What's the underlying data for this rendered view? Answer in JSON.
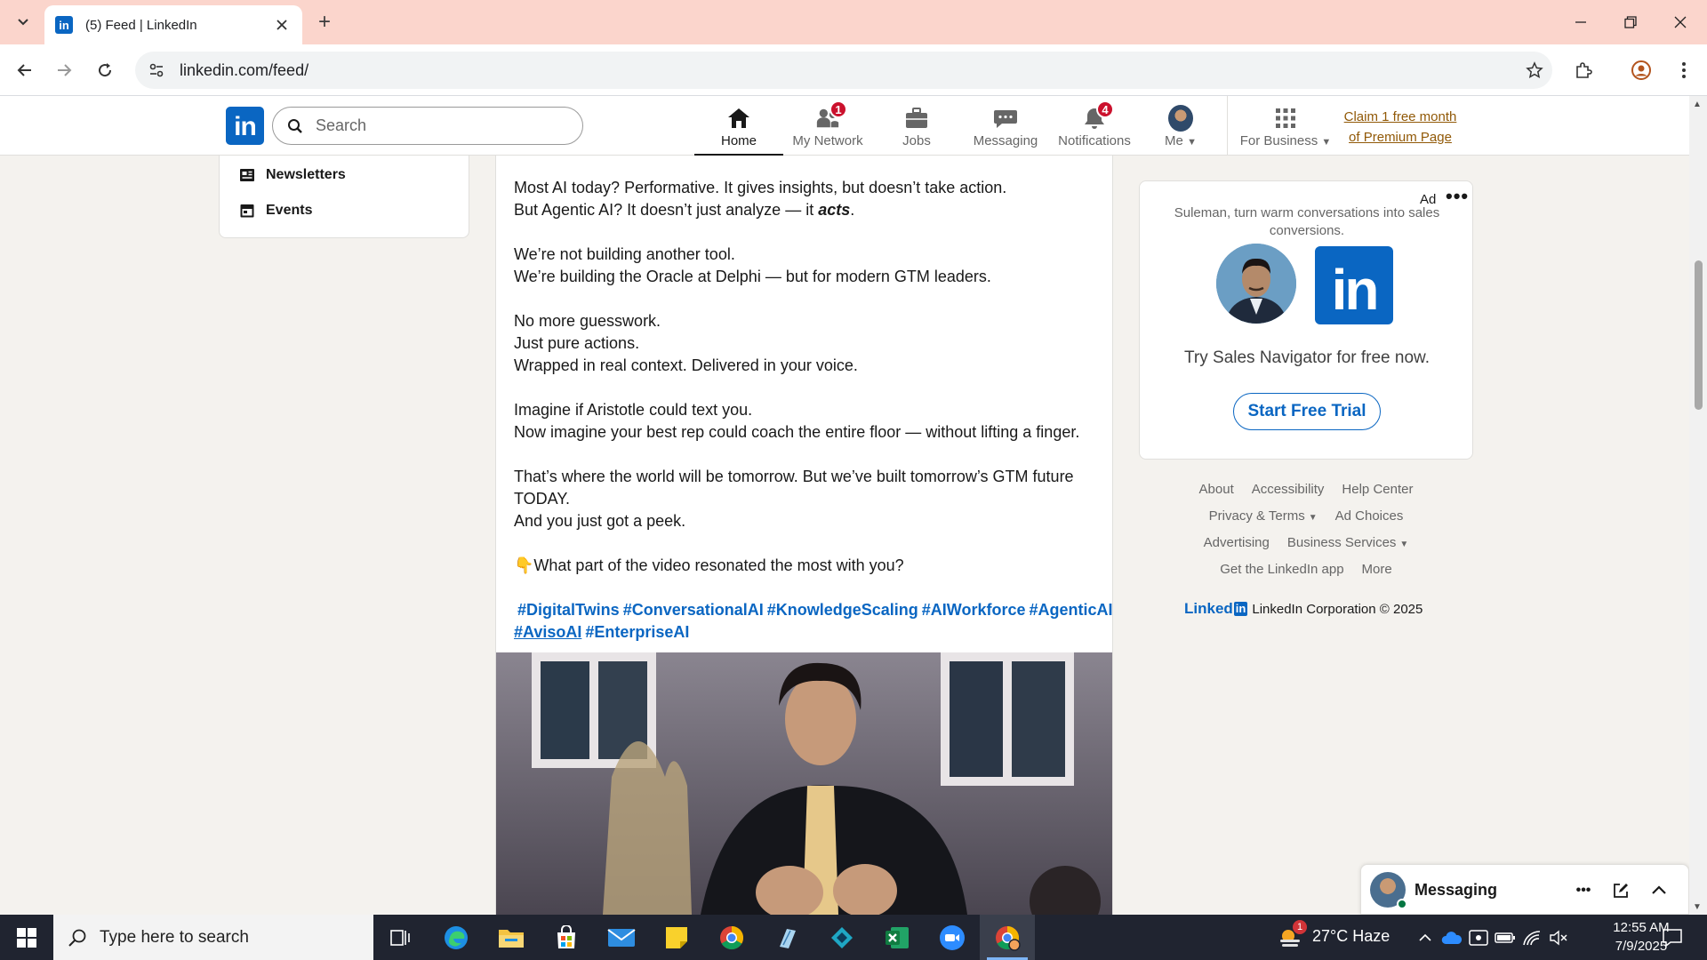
{
  "browser": {
    "tab_title": "(5) Feed | LinkedIn",
    "url": "linkedin.com/feed/",
    "new_tab": "+"
  },
  "linkedin": {
    "logo_text": "in",
    "search_placeholder": "Search",
    "nav": [
      {
        "label": "Home",
        "badge": ""
      },
      {
        "label": "My Network",
        "badge": "1"
      },
      {
        "label": "Jobs",
        "badge": ""
      },
      {
        "label": "Messaging",
        "badge": ""
      },
      {
        "label": "Notifications",
        "badge": "4"
      },
      {
        "label": "Me",
        "badge": ""
      },
      {
        "label": "For Business",
        "badge": ""
      }
    ],
    "premium_line1": "Claim 1 free month",
    "premium_line2": "of Premium Page"
  },
  "left_sidebar": {
    "items": [
      "Newsletters",
      "Events"
    ]
  },
  "post": {
    "lines_1": [
      "Most AI today? Performative. It gives insights, but doesn’t take action."
    ],
    "line_2_pre": "But Agentic AI? It doesn’t just analyze — it ",
    "line_2_em": "acts",
    "line_2_post": ".",
    "para_2": [
      "We’re not building another tool.",
      "We’re building the Oracle at Delphi — but for modern GTM leaders."
    ],
    "para_3": [
      "No more guesswork.",
      "Just pure actions.",
      "Wrapped in real context. Delivered in your voice."
    ],
    "para_4": [
      "Imagine if Aristotle could text you.",
      "Now imagine your best rep could coach the entire floor — without lifting a finger."
    ],
    "para_5": [
      "That’s where the world will be tomorrow. But we’ve built tomorrow’s GTM future TODAY.",
      "And you just got a peek."
    ],
    "question_emoji": "👇",
    "question": "What part of the video resonated the most with you?",
    "hashtags": [
      "#DigitalTwins",
      "#ConversationalAI",
      "#KnowledgeScaling",
      "#AIWorkforce",
      "#AgenticAI",
      "#AvisoAI",
      "#EnterpriseAI"
    ]
  },
  "ad": {
    "label": "Ad",
    "more": "•••",
    "subtitle": "Suleman, turn warm conversations into sales conversions.",
    "logo_text": "in",
    "cta_text": "Try Sales Navigator for free now.",
    "button": "Start Free Trial"
  },
  "footer": {
    "row1": [
      "About",
      "Accessibility",
      "Help Center"
    ],
    "row2": [
      "Privacy & Terms",
      "Ad Choices"
    ],
    "row3": [
      "Advertising",
      "Business Services"
    ],
    "row4": [
      "Get the LinkedIn app",
      "More"
    ],
    "brand_word": "Linked",
    "brand_in": "in",
    "copyright": "LinkedIn Corporation © 2025"
  },
  "messaging": {
    "title": "Messaging",
    "more": "•••"
  },
  "taskbar": {
    "search_placeholder": "Type here to search",
    "weather": "27°C  Haze",
    "weather_badge": "1",
    "time": "12:55 AM",
    "date": "7/9/2025"
  },
  "colors": {
    "linkedin_blue": "#0a66c2",
    "premium_gold": "#915907",
    "badge_red": "#cb112d",
    "tabbar": "#fbd5cc"
  }
}
